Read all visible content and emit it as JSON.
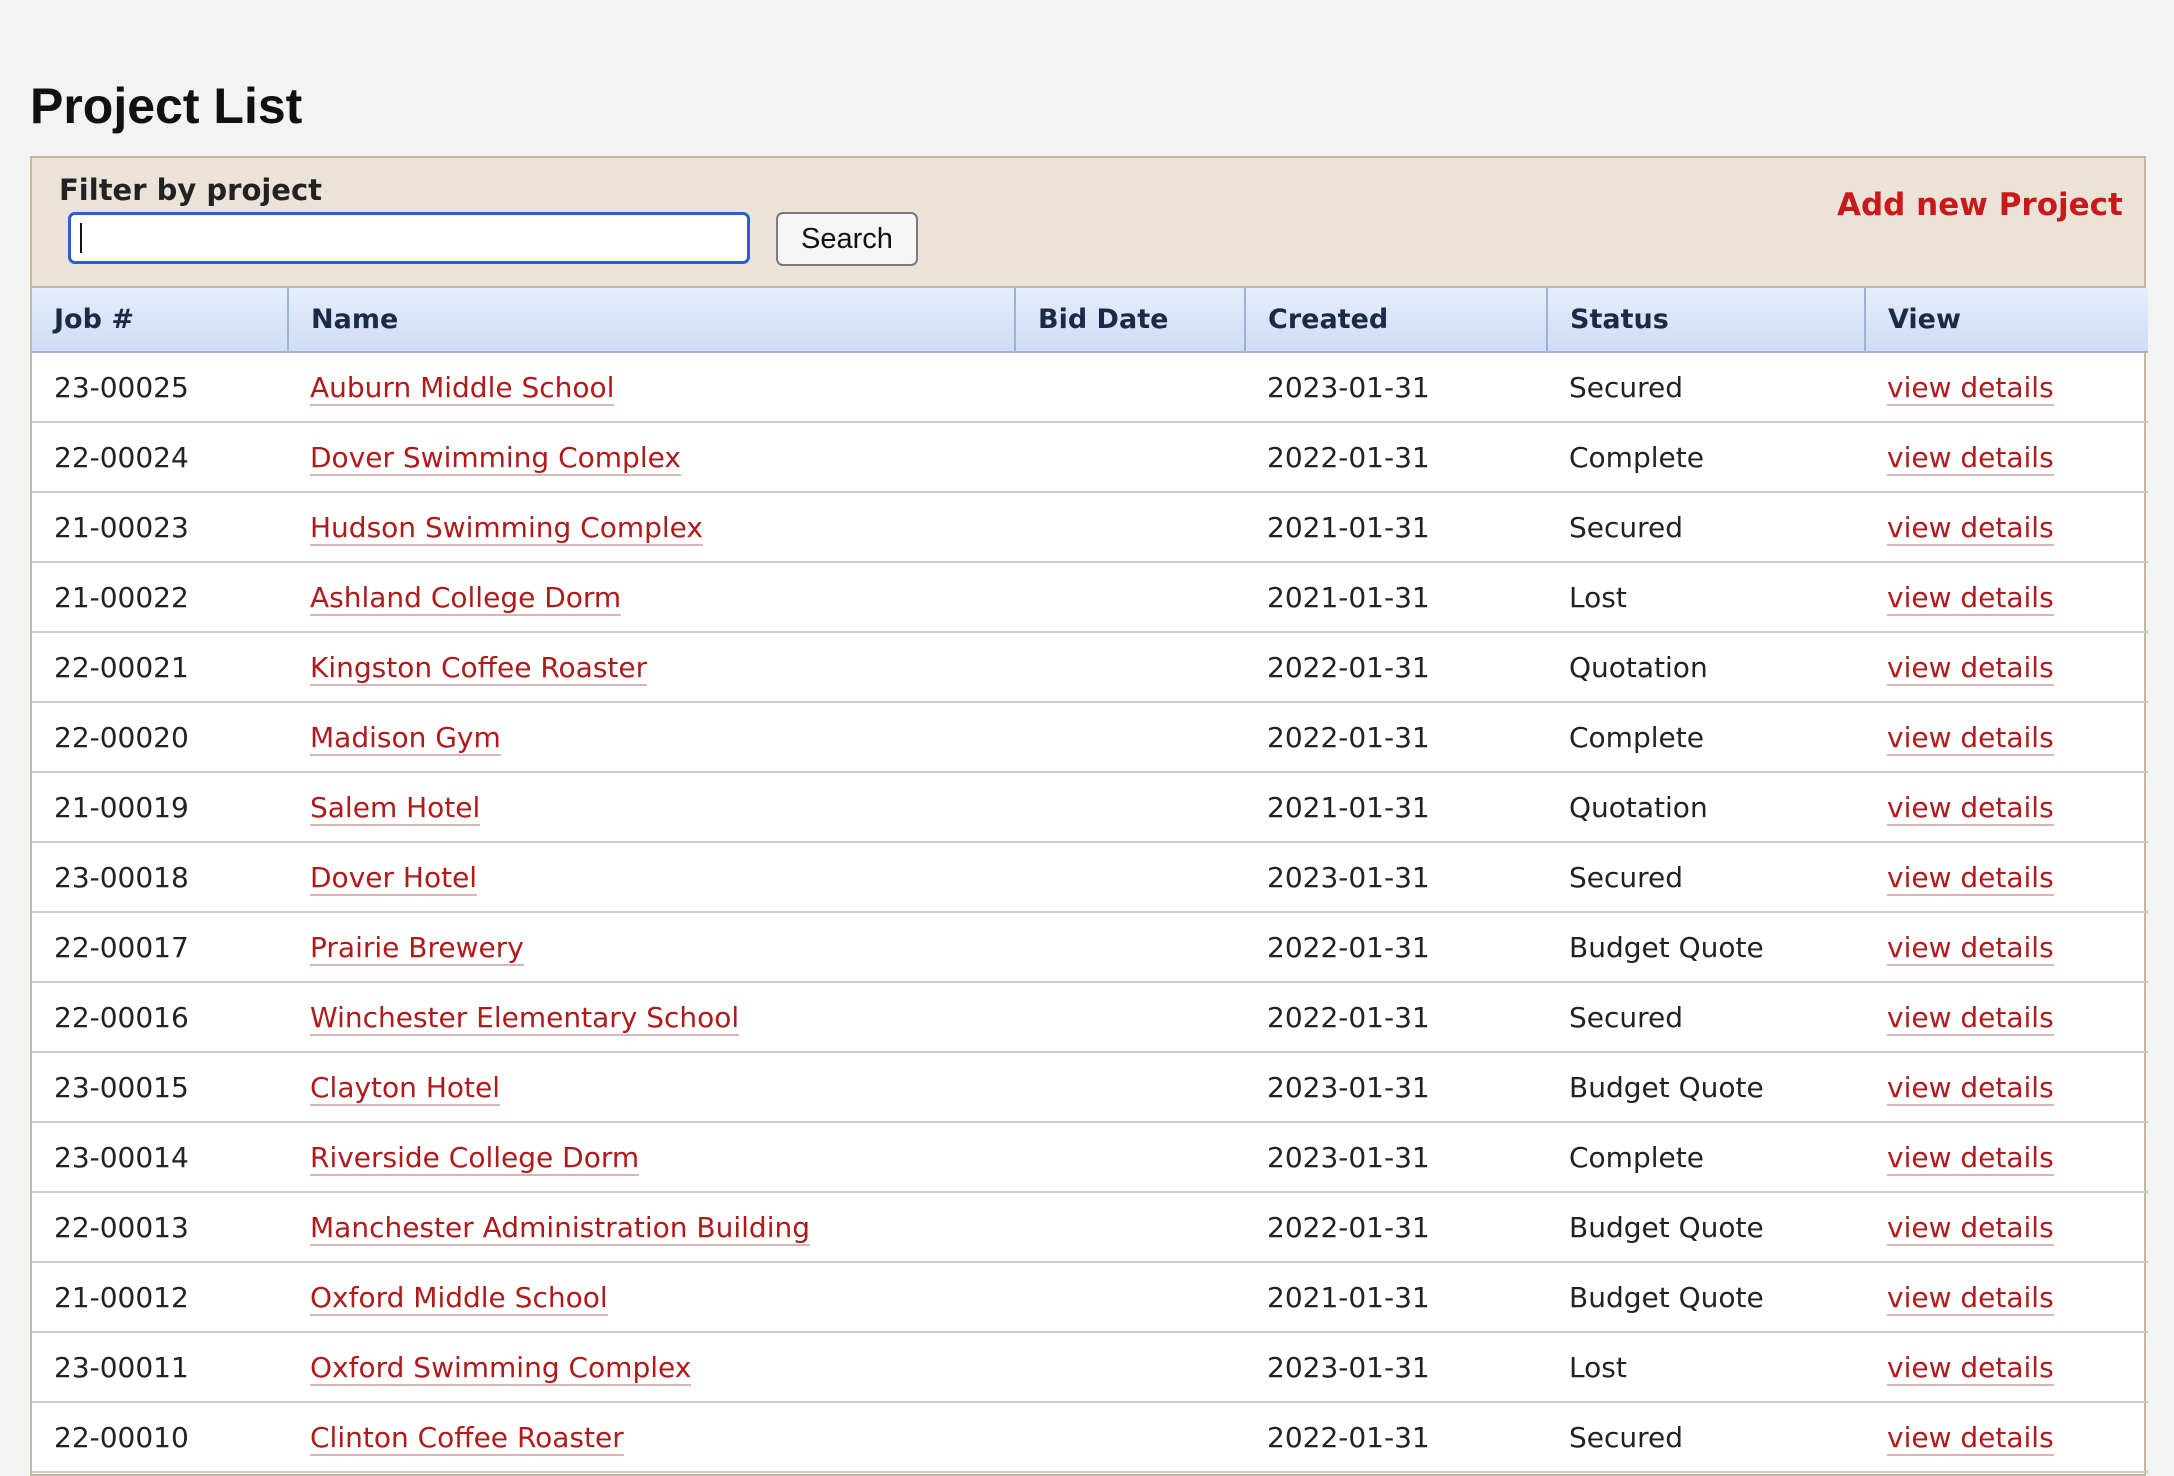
{
  "page": {
    "title": "Project List"
  },
  "filter": {
    "label": "Filter by project",
    "value": "",
    "placeholder": "",
    "search_label": "Search",
    "add_label": "Add new Project"
  },
  "table": {
    "headers": {
      "job": "Job #",
      "name": "Name",
      "bid_date": "Bid Date",
      "created": "Created",
      "status": "Status",
      "view": "View"
    },
    "rows": [
      {
        "job": "23-00025",
        "name": "Auburn Middle School",
        "bid_date": "",
        "created": "2023-01-31",
        "status": "Secured",
        "view": "view details"
      },
      {
        "job": "22-00024",
        "name": "Dover Swimming Complex",
        "bid_date": "",
        "created": "2022-01-31",
        "status": "Complete",
        "view": "view details"
      },
      {
        "job": "21-00023",
        "name": "Hudson Swimming Complex",
        "bid_date": "",
        "created": "2021-01-31",
        "status": "Secured",
        "view": "view details"
      },
      {
        "job": "21-00022",
        "name": "Ashland College Dorm",
        "bid_date": "",
        "created": "2021-01-31",
        "status": "Lost",
        "view": "view details"
      },
      {
        "job": "22-00021",
        "name": "Kingston Coffee Roaster",
        "bid_date": "",
        "created": "2022-01-31",
        "status": "Quotation",
        "view": "view details"
      },
      {
        "job": "22-00020",
        "name": "Madison Gym",
        "bid_date": "",
        "created": "2022-01-31",
        "status": "Complete",
        "view": "view details"
      },
      {
        "job": "21-00019",
        "name": "Salem Hotel",
        "bid_date": "",
        "created": "2021-01-31",
        "status": "Quotation",
        "view": "view details"
      },
      {
        "job": "23-00018",
        "name": "Dover Hotel",
        "bid_date": "",
        "created": "2023-01-31",
        "status": "Secured",
        "view": "view details"
      },
      {
        "job": "22-00017",
        "name": "Prairie Brewery",
        "bid_date": "",
        "created": "2022-01-31",
        "status": "Budget Quote",
        "view": "view details"
      },
      {
        "job": "22-00016",
        "name": "Winchester Elementary School",
        "bid_date": "",
        "created": "2022-01-31",
        "status": "Secured",
        "view": "view details"
      },
      {
        "job": "23-00015",
        "name": "Clayton Hotel",
        "bid_date": "",
        "created": "2023-01-31",
        "status": "Budget Quote",
        "view": "view details"
      },
      {
        "job": "23-00014",
        "name": "Riverside College Dorm",
        "bid_date": "",
        "created": "2023-01-31",
        "status": "Complete",
        "view": "view details"
      },
      {
        "job": "22-00013",
        "name": "Manchester Administration Building",
        "bid_date": "",
        "created": "2022-01-31",
        "status": "Budget Quote",
        "view": "view details"
      },
      {
        "job": "21-00012",
        "name": "Oxford Middle School",
        "bid_date": "",
        "created": "2021-01-31",
        "status": "Budget Quote",
        "view": "view details"
      },
      {
        "job": "23-00011",
        "name": "Oxford Swimming Complex",
        "bid_date": "",
        "created": "2023-01-31",
        "status": "Lost",
        "view": "view details"
      },
      {
        "job": "22-00010",
        "name": "Clinton Coffee Roaster",
        "bid_date": "",
        "created": "2022-01-31",
        "status": "Secured",
        "view": "view details"
      }
    ]
  },
  "colors": {
    "link": "#b01a1a",
    "add_link": "#c8191b",
    "filter_bg": "#ebe3d8",
    "header_bg": "#d9e4f7",
    "input_focus": "#2a5ed3"
  }
}
